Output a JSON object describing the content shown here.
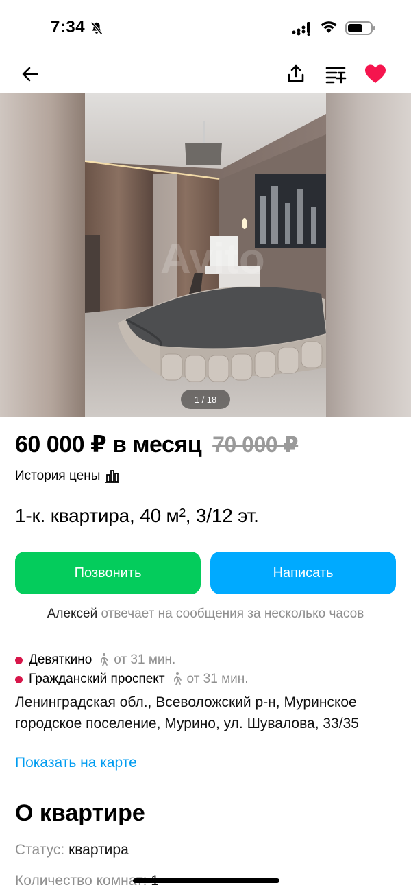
{
  "status_bar": {
    "time": "7:34"
  },
  "nav": {
    "icons": [
      "back-arrow-icon",
      "share-icon",
      "compare-list-icon",
      "heart-icon"
    ],
    "favorite_color": "#f5154e"
  },
  "gallery": {
    "counter": "1 / 18",
    "watermark": "Avito"
  },
  "listing": {
    "price": "60 000 ₽ в месяц",
    "old_price": "70 000 ₽",
    "price_history": "История цены",
    "title": "1-к. квартира, 40 м², 3/12 эт."
  },
  "actions": {
    "call_label": "Позвонить",
    "call_color": "#04cc5c",
    "write_label": "Написать",
    "write_color": "#00aaff"
  },
  "seller": {
    "name": "Алексей",
    "response_note": " отвечает на сообщения за несколько часов"
  },
  "location": {
    "metro": [
      {
        "station": "Девяткино",
        "walk_time": "от 31 мин."
      },
      {
        "station": "Гражданский проспект",
        "walk_time": "от 31 мин."
      }
    ],
    "metro_color": "#d7164a",
    "address": "Ленинградская обл., Всеволожский р-н, Муринское городское поселение, Мурино, ул. Шувалова, 33/35",
    "map_link": "Показать на карте"
  },
  "about": {
    "title": "О квартире",
    "params": [
      {
        "label": "Статус:",
        "value": "квартира"
      },
      {
        "label": "Количество комнат:",
        "value": "1"
      }
    ]
  }
}
